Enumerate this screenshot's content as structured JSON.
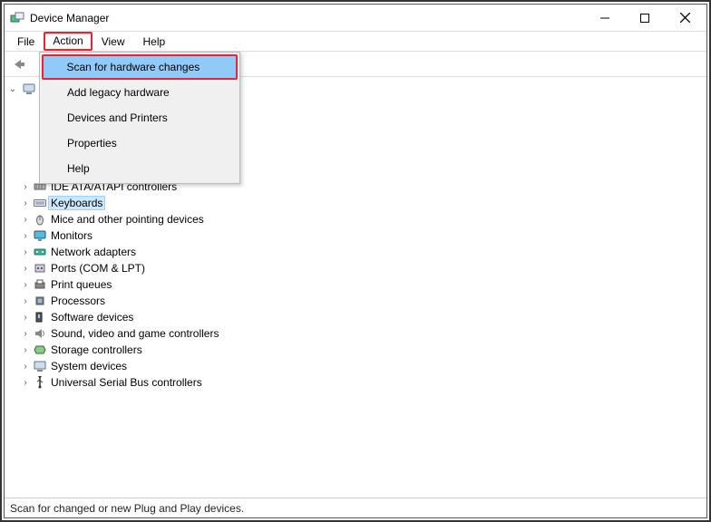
{
  "window": {
    "title": "Device Manager"
  },
  "menubar": {
    "items": [
      "File",
      "Action",
      "View",
      "Help"
    ],
    "active_index": 1
  },
  "dropdown": {
    "items": [
      "Scan for hardware changes",
      "Add legacy hardware",
      "Devices and Printers",
      "Properties",
      "Help"
    ],
    "selected_index": 0
  },
  "tree": {
    "root": "",
    "items": [
      {
        "label": "",
        "icon": "audio-icon",
        "selected": false,
        "hidden_by_menu": true
      },
      {
        "label": "",
        "icon": "computer-icon",
        "selected": false,
        "hidden_by_menu": true
      },
      {
        "label": "",
        "icon": "disk-icon",
        "selected": false,
        "hidden_by_menu": true
      },
      {
        "label": "",
        "icon": "display-icon",
        "selected": false,
        "hidden_by_menu": true
      },
      {
        "label": "",
        "icon": "hid-icon",
        "selected": false,
        "hidden_by_menu": true
      },
      {
        "label": "IDE ATA/ATAPI controllers",
        "icon": "ide-icon",
        "selected": false
      },
      {
        "label": "Keyboards",
        "icon": "keyboard-icon",
        "selected": true
      },
      {
        "label": "Mice and other pointing devices",
        "icon": "mouse-icon",
        "selected": false
      },
      {
        "label": "Monitors",
        "icon": "monitor-icon",
        "selected": false
      },
      {
        "label": "Network adapters",
        "icon": "network-icon",
        "selected": false
      },
      {
        "label": "Ports (COM & LPT)",
        "icon": "ports-icon",
        "selected": false
      },
      {
        "label": "Print queues",
        "icon": "printer-icon",
        "selected": false
      },
      {
        "label": "Processors",
        "icon": "cpu-icon",
        "selected": false
      },
      {
        "label": "Software devices",
        "icon": "software-icon",
        "selected": false
      },
      {
        "label": "Sound, video and game controllers",
        "icon": "sound-icon",
        "selected": false
      },
      {
        "label": "Storage controllers",
        "icon": "storage-icon",
        "selected": false
      },
      {
        "label": "System devices",
        "icon": "system-icon",
        "selected": false
      },
      {
        "label": "Universal Serial Bus controllers",
        "icon": "usb-icon",
        "selected": false
      }
    ]
  },
  "statusbar": {
    "text": "Scan for changed or new Plug and Play devices."
  }
}
